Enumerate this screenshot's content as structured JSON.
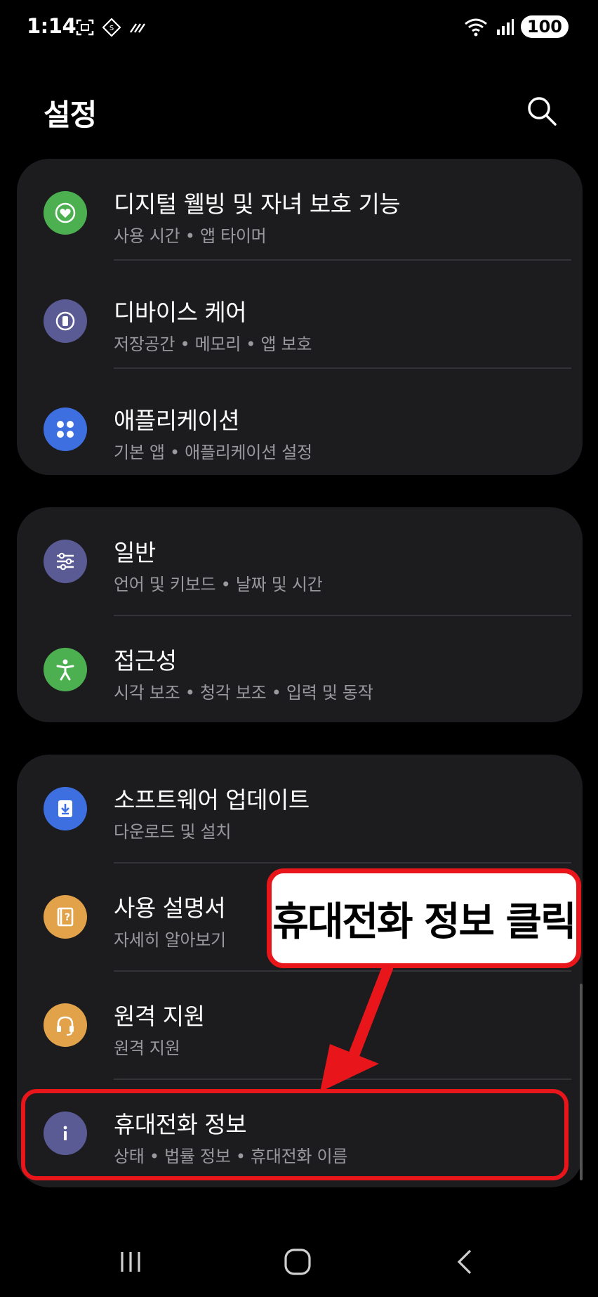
{
  "status": {
    "time": "1:14",
    "battery": "100",
    "left_icons": [
      "screenshot-icon",
      "settings-badge-icon",
      "network-icon"
    ],
    "right_icons": [
      "wifi-icon",
      "signal-icon"
    ]
  },
  "header": {
    "title": "설정",
    "search_icon": "search-icon"
  },
  "groups": [
    {
      "items": [
        {
          "title": "디지털 웰빙 및 자녀 보호 기능",
          "subtitle": "사용 시간 • 앱 타이머",
          "icon": "digital-wellbeing-icon",
          "color": "#4caf50"
        },
        {
          "title": "디바이스 케어",
          "subtitle": "저장공간 • 메모리 • 앱 보호",
          "icon": "device-care-icon",
          "color": "#5a5a94"
        },
        {
          "title": "애플리케이션",
          "subtitle": "기본 앱 • 애플리케이션 설정",
          "icon": "apps-icon",
          "color": "#3d6fe0"
        }
      ]
    },
    {
      "items": [
        {
          "title": "일반",
          "subtitle": "언어 및 키보드 • 날짜 및 시간",
          "icon": "general-icon",
          "color": "#5a5a94"
        },
        {
          "title": "접근성",
          "subtitle": "시각 보조 • 청각 보조 • 입력 및 동작",
          "icon": "accessibility-icon",
          "color": "#4caf50"
        }
      ]
    },
    {
      "items": [
        {
          "title": "소프트웨어 업데이트",
          "subtitle": "다운로드 및 설치",
          "icon": "software-update-icon",
          "color": "#3d6fe0"
        },
        {
          "title": "사용 설명서",
          "subtitle": "자세히 알아보기",
          "icon": "user-manual-icon",
          "color": "#e2a24a"
        },
        {
          "title": "원격 지원",
          "subtitle": "원격 지원",
          "icon": "remote-support-icon",
          "color": "#e2a24a"
        },
        {
          "title": "휴대전화 정보",
          "subtitle": "상태 • 법률 정보 • 휴대전화 이름",
          "icon": "info-icon",
          "color": "#5a5a94"
        }
      ]
    }
  ],
  "annotation": {
    "callout_text": "휴대전화 정보 클릭",
    "color": "#e8161b"
  },
  "navbar": {
    "recents_icon": "recents-icon",
    "home_icon": "home-icon",
    "back_icon": "back-icon"
  }
}
